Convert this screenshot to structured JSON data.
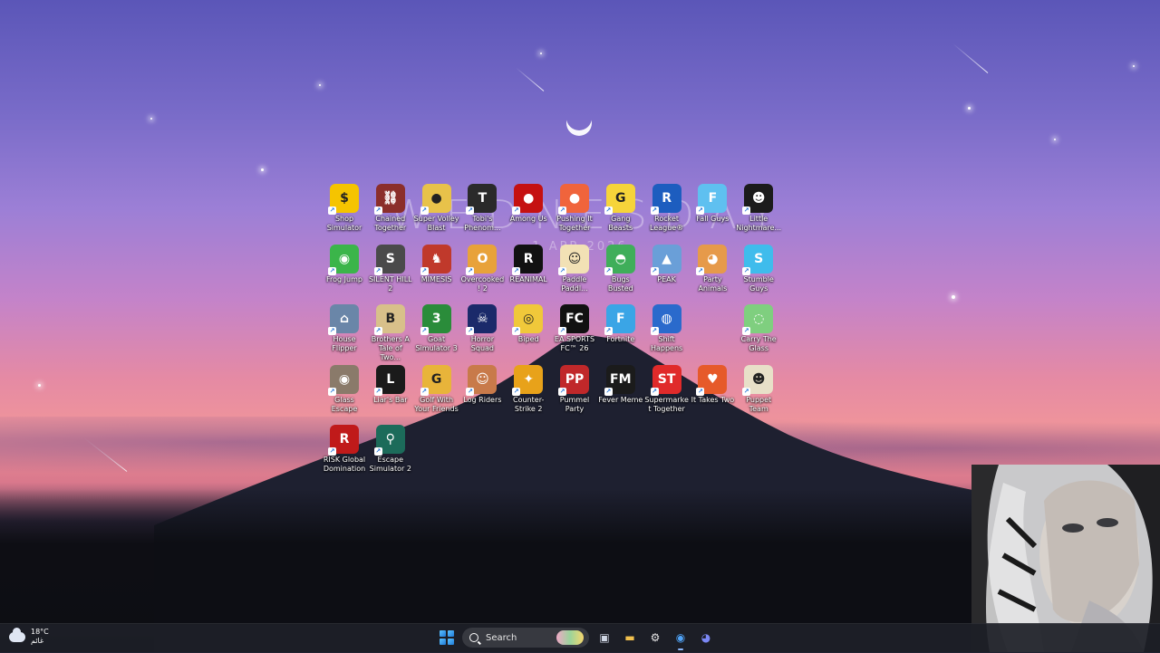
{
  "widget": {
    "day": "WEDNESDAY",
    "date": "1 APR 2026"
  },
  "desktop_icons": [
    {
      "label": "Shop Simulator",
      "icon": "dollar-icon",
      "color": "#f5c400",
      "glyph": "$"
    },
    {
      "label": "Chained Together",
      "icon": "chain-icon",
      "color": "#8b2e2a",
      "glyph": "⛓"
    },
    {
      "label": "Super Volley Blast",
      "icon": "volleyball-icon",
      "color": "#e8c24a",
      "glyph": "●"
    },
    {
      "label": "Tobi's Phenom...",
      "icon": "book-icon",
      "color": "#2a2a2a",
      "glyph": "T"
    },
    {
      "label": "Among Us",
      "icon": "crewmate-icon",
      "color": "#c51111",
      "glyph": "●"
    },
    {
      "label": "Pushing It Together",
      "icon": "blob-icon",
      "color": "#f0643c",
      "glyph": "●"
    },
    {
      "label": "Gang Beasts",
      "icon": "gang-beasts-icon",
      "color": "#f6d43a",
      "glyph": "G"
    },
    {
      "label": "Rocket League®",
      "icon": "rocket-league-icon",
      "color": "#1d5dbf",
      "glyph": "R"
    },
    {
      "label": "Fall Guys",
      "icon": "fall-guys-icon",
      "color": "#5fc0f0",
      "glyph": "F"
    },
    {
      "label": "Little Nightmare...",
      "icon": "cat-icon",
      "color": "#1b1b1b",
      "glyph": "☻"
    },
    {
      "label": "Frog Jump",
      "icon": "frog-icon",
      "color": "#3bb54a",
      "glyph": "◉"
    },
    {
      "label": "SILENT HILL 2",
      "icon": "silent-hill-icon",
      "color": "#4a4a4a",
      "glyph": "S"
    },
    {
      "label": "MIMESIS",
      "icon": "chicken-icon",
      "color": "#c0392b",
      "glyph": "♞"
    },
    {
      "label": "Overcooked! 2",
      "icon": "overcooked-icon",
      "color": "#e8a23a",
      "glyph": "O"
    },
    {
      "label": "REANIMAL",
      "icon": "reanimal-icon",
      "color": "#111111",
      "glyph": "R"
    },
    {
      "label": "Paddle Paddl...",
      "icon": "face-icon",
      "color": "#f2e1b5",
      "glyph": "☺"
    },
    {
      "label": "Bugs Busted",
      "icon": "alien-icon",
      "color": "#3fae5a",
      "glyph": "◓"
    },
    {
      "label": "PEAK",
      "icon": "peak-icon",
      "color": "#6a9fd8",
      "glyph": "▲"
    },
    {
      "label": "Party Animals",
      "icon": "dog-icon",
      "color": "#e69a4a",
      "glyph": "◕"
    },
    {
      "label": "Stumble Guys",
      "icon": "stumble-icon",
      "color": "#3fbcec",
      "glyph": "S"
    },
    {
      "label": "House Flipper",
      "icon": "house-icon",
      "color": "#6a86a8",
      "glyph": "⌂"
    },
    {
      "label": "Brothers A Tale of Two...",
      "icon": "brothers-icon",
      "color": "#d8c08a",
      "glyph": "B"
    },
    {
      "label": "Goat Simulator 3",
      "icon": "goat-icon",
      "color": "#2a8c3a",
      "glyph": "3"
    },
    {
      "label": "Horror Squad",
      "icon": "horror-icon",
      "color": "#1b2a6a",
      "glyph": "☠"
    },
    {
      "label": "Biped",
      "icon": "biped-icon",
      "color": "#f0c83a",
      "glyph": "◎"
    },
    {
      "label": "EA SPORTS FC™ 26",
      "icon": "fc26-icon",
      "color": "#111111",
      "glyph": "FC"
    },
    {
      "label": "Fortnite",
      "icon": "fortnite-icon",
      "color": "#3aa5e6",
      "glyph": "F"
    },
    {
      "label": "Shift Happens",
      "icon": "shift-icon",
      "color": "#2a6acc",
      "glyph": "◍"
    },
    {
      "label": "Carry The Glass",
      "icon": "glass-icon",
      "color": "#7fcf7f",
      "glyph": "◌"
    },
    {
      "label": "Glass Escape",
      "icon": "glass-escape-icon",
      "color": "#8a7a6a",
      "glyph": "◉"
    },
    {
      "label": "Liar's Bar",
      "icon": "liars-bar-icon",
      "color": "#1a1a1a",
      "glyph": "L"
    },
    {
      "label": "Golf With Your Friends",
      "icon": "golf-icon",
      "color": "#e8b43a",
      "glyph": "G"
    },
    {
      "label": "Log Riders",
      "icon": "log-riders-icon",
      "color": "#c87a4a",
      "glyph": "☺"
    },
    {
      "label": "Counter-Strike 2",
      "icon": "cs2-icon",
      "color": "#e8a21a",
      "glyph": "✦"
    },
    {
      "label": "Pummel Party",
      "icon": "pummel-icon",
      "color": "#c0282a",
      "glyph": "PP"
    },
    {
      "label": "Fever Meme",
      "icon": "fever-meme-icon",
      "color": "#1b1b1b",
      "glyph": "FM"
    },
    {
      "label": "Supermarket Together",
      "icon": "supermarket-icon",
      "color": "#e02a2a",
      "glyph": "ST"
    },
    {
      "label": "It Takes Two",
      "icon": "it-takes-two-icon",
      "color": "#e65a2a",
      "glyph": "♥"
    },
    {
      "label": "Puppet Team",
      "icon": "puppet-icon",
      "color": "#e8e0c8",
      "glyph": "☻"
    },
    {
      "label": "RISK Global Domination",
      "icon": "risk-icon",
      "color": "#c01a1a",
      "glyph": "R"
    },
    {
      "label": "Escape Simulator 2",
      "icon": "keyhole-icon",
      "color": "#1c6b5a",
      "glyph": "⚲"
    }
  ],
  "taskbar": {
    "weather_temp": "18°C",
    "weather_desc": "غائم",
    "search_placeholder": "Search",
    "apps": [
      {
        "name": "task-view-icon",
        "glyph": "▣",
        "color": "#cfd6e4"
      },
      {
        "name": "file-explorer-icon",
        "glyph": "▬",
        "color": "#f2c14e"
      },
      {
        "name": "steam-icon",
        "glyph": "⚙",
        "color": "#e6e6e6"
      },
      {
        "name": "chrome-icon",
        "glyph": "◉",
        "color": "#4fa3f7"
      },
      {
        "name": "discord-icon",
        "glyph": "◕",
        "color": "#7b88f5"
      }
    ]
  }
}
